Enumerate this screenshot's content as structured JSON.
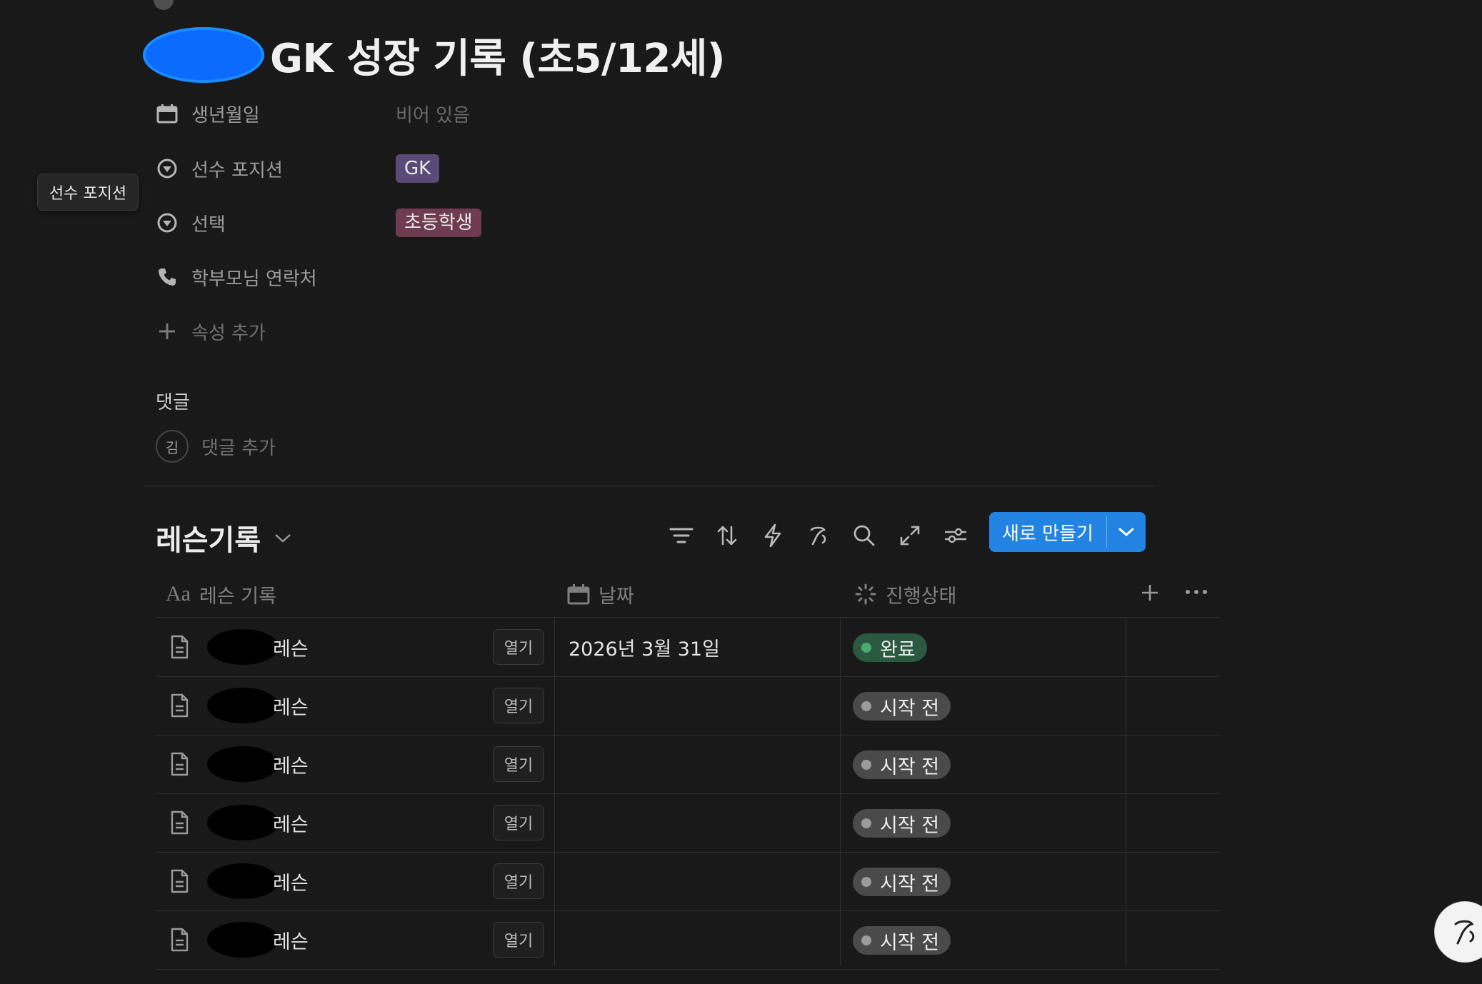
{
  "page": {
    "title": "GK 성장 기록 (초5/12세)"
  },
  "properties": [
    {
      "icon": "calendar-icon",
      "label": "생년월일",
      "value": "비어 있음",
      "type": "empty"
    },
    {
      "icon": "select-icon",
      "label": "선수 포지션",
      "value": "GK",
      "type": "tag",
      "color": "#5a4a78"
    },
    {
      "icon": "select-icon",
      "label": "선택",
      "value": "초등학생",
      "type": "tag",
      "color": "#6e3b50"
    },
    {
      "icon": "phone-icon",
      "label": "학부모님 연락처",
      "value": "",
      "type": "none"
    },
    {
      "icon": "plus-icon",
      "label": "속성 추가",
      "value": "",
      "type": "action"
    }
  ],
  "tooltip": {
    "text": "선수 포지션"
  },
  "comments": {
    "label": "댓글",
    "avatar_initial": "김",
    "placeholder": "댓글 추가"
  },
  "database": {
    "title": "레슨기록",
    "new_button_label": "새로 만들기",
    "toolbar_icons": [
      "filter-icon",
      "sort-icon",
      "automation-icon",
      "ai-icon",
      "search-icon",
      "expand-icon",
      "settings-icon"
    ],
    "columns": [
      {
        "icon": "text-icon",
        "icon_text": "Aa",
        "label": "레슨 기록"
      },
      {
        "icon": "calendar-icon",
        "label": "날짜"
      },
      {
        "icon": "status-icon",
        "label": "진행상태"
      }
    ],
    "open_label": "열기",
    "rows": [
      {
        "name": "레슨",
        "date": "2026년 3월 31일",
        "status": "완료",
        "status_type": "done"
      },
      {
        "name": "레슨",
        "date": "",
        "status": "시작 전",
        "status_type": "todo"
      },
      {
        "name": "레슨",
        "date": "",
        "status": "시작 전",
        "status_type": "todo"
      },
      {
        "name": "레슨",
        "date": "",
        "status": "시작 전",
        "status_type": "todo"
      },
      {
        "name": "레슨",
        "date": "",
        "status": "시작 전",
        "status_type": "todo"
      },
      {
        "name": "레슨",
        "date": "",
        "status": "시작 전",
        "status_type": "todo"
      }
    ]
  },
  "colors": {
    "background": "#191919",
    "accent": "#2383e2",
    "done": "#2b593f",
    "todo": "#4a4a4a"
  }
}
